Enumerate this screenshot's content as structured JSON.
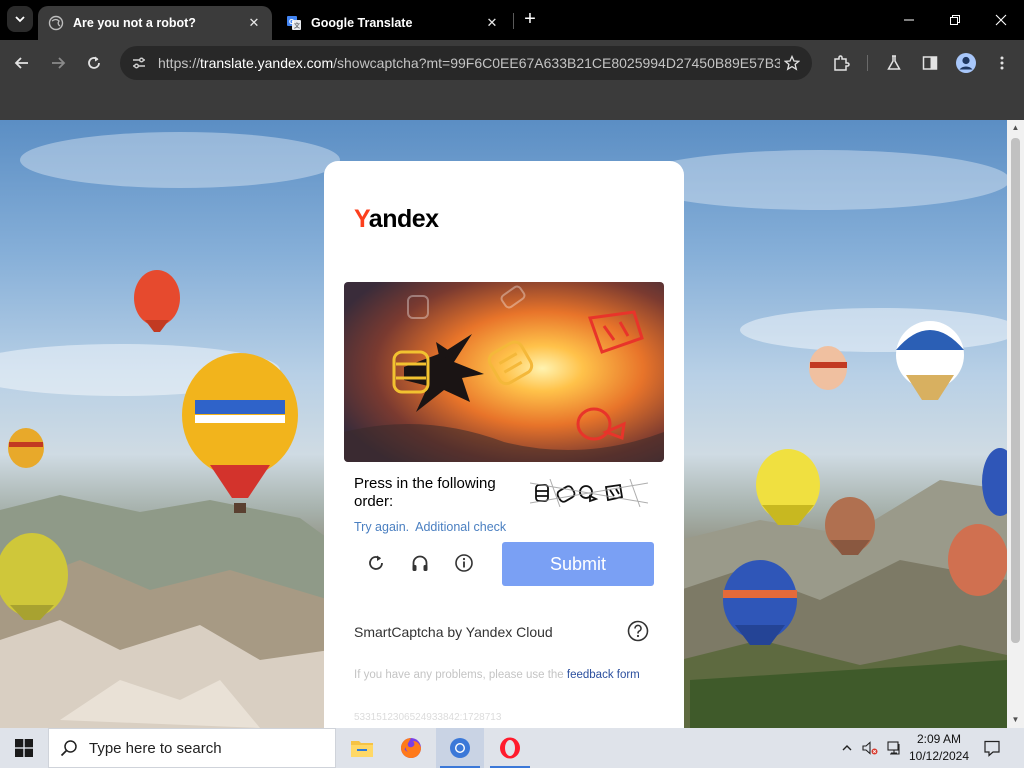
{
  "browser": {
    "tabs": [
      {
        "title": "Are you not a robot?",
        "active": true
      },
      {
        "title": "Google Translate",
        "active": false
      }
    ],
    "address": {
      "prefix": "https://",
      "host": "translate.yandex.com",
      "path": "/showcaptcha?mt=99F6C0EE67A633B21CE8025994D27450B89E57B3E..."
    }
  },
  "captcha": {
    "logo_first": "Y",
    "logo_rest": "andex",
    "instruction": "Press in the following order:",
    "try_again": "Try again.",
    "additional_check": "Additional check",
    "submit_label": "Submit",
    "smartcaptcha": "SmartCaptcha by Yandex Cloud",
    "problems_text": "If you have any problems, please use the ",
    "feedback_link": "feedback form",
    "request_id": "5331512306524933842:1728713"
  },
  "taskbar": {
    "search_placeholder": "Type here to search",
    "time": "2:09 AM",
    "date": "10/12/2024"
  },
  "colors": {
    "submit": "#7aa0f4",
    "link": "#4a7fc1",
    "yandex_red": "#fc3f1d",
    "chrome_dark": "#3b3b3b"
  }
}
